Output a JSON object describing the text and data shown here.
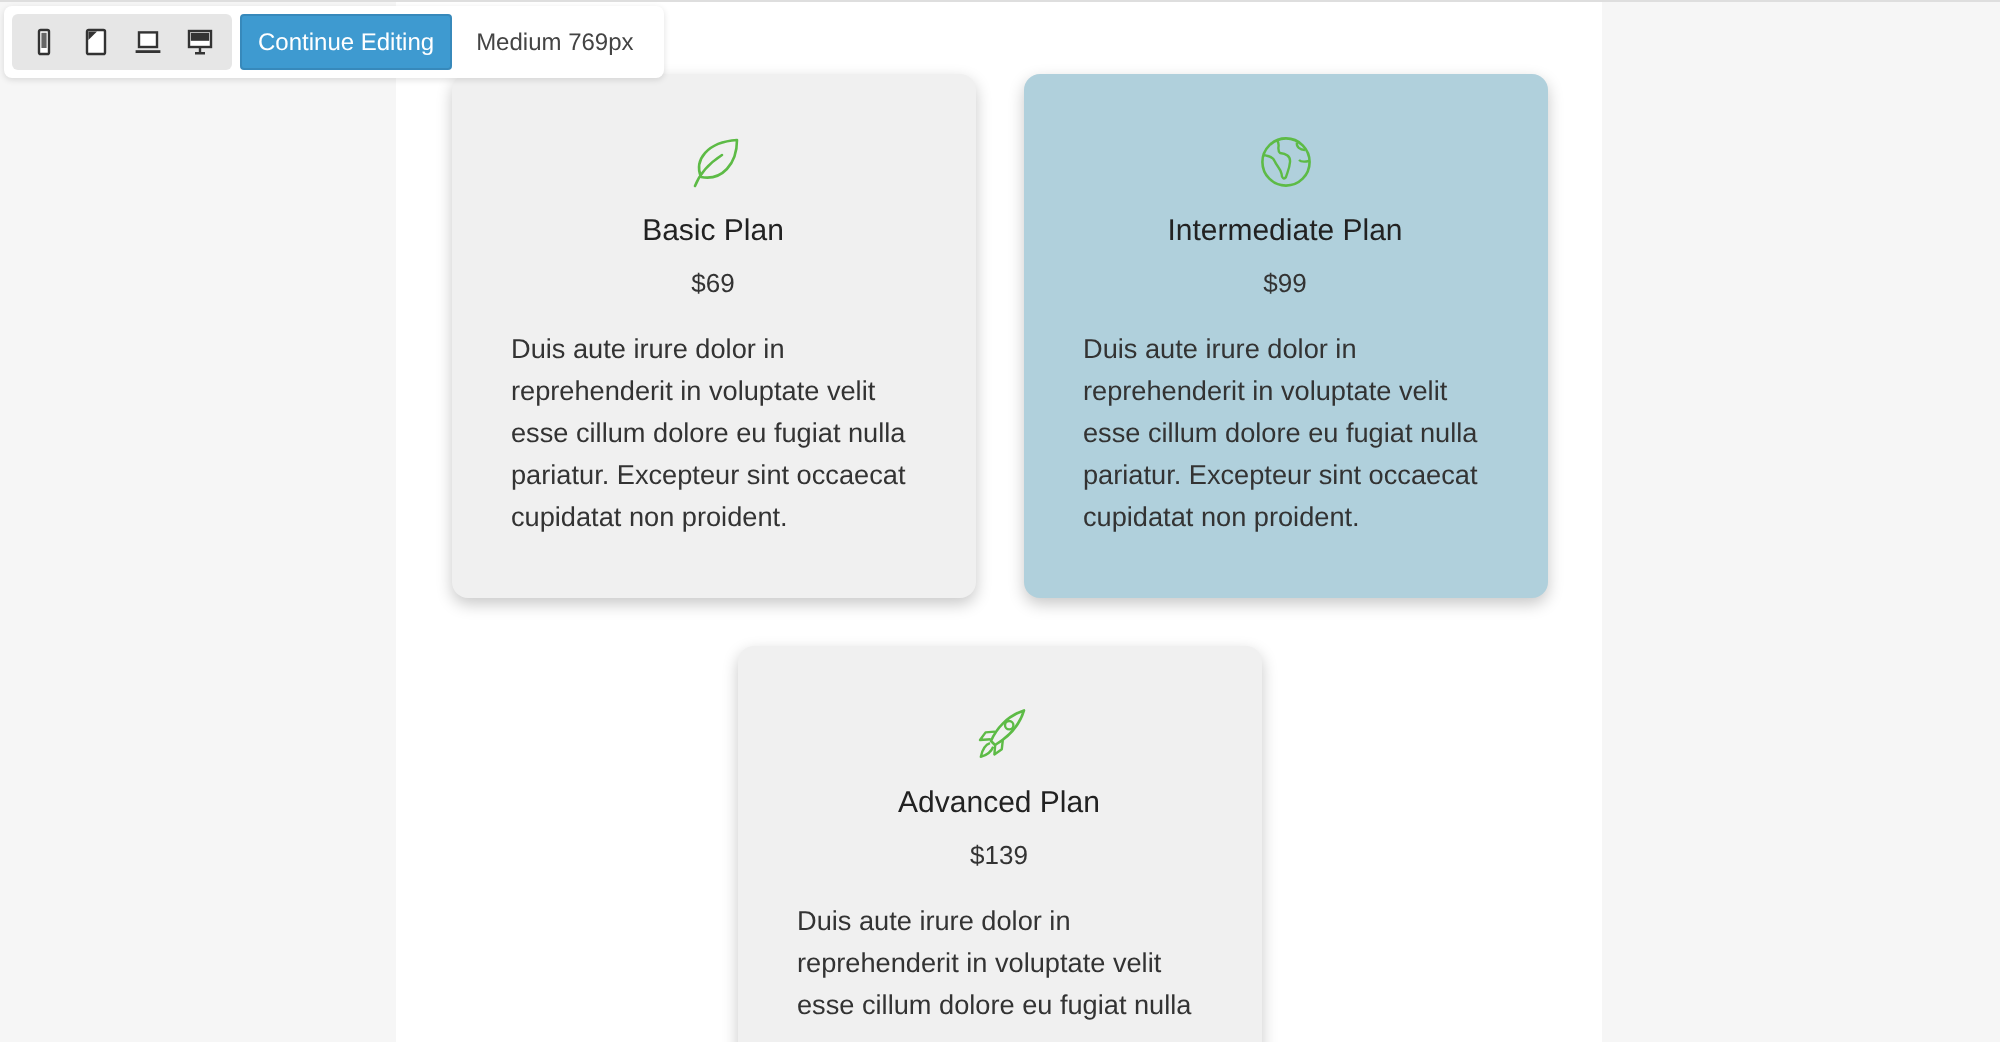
{
  "toolbar": {
    "devices": [
      {
        "kind": "phone"
      },
      {
        "kind": "tablet"
      },
      {
        "kind": "laptop"
      },
      {
        "kind": "desktop"
      }
    ],
    "continue_button": "Continue Editing",
    "breakpoint": "Medium 769px"
  },
  "plans": [
    {
      "kind": "leaf",
      "title": "Basic Plan",
      "price": "$69",
      "description": "Duis aute irure dolor in reprehenderit in voluptate velit esse cillum dolore eu fugiat nulla pariatur. Excepteur sint occaecat cupidatat non proident.",
      "featured": false
    },
    {
      "kind": "globe",
      "title": "Intermediate Plan",
      "price": "$99",
      "description": "Duis aute irure dolor in reprehenderit in voluptate velit esse cillum dolore eu fugiat nulla pariatur. Excepteur sint occaecat cupidatat non proident.",
      "featured": true
    },
    {
      "kind": "rocket",
      "title": "Advanced Plan",
      "price": "$139",
      "description": "Duis aute irure dolor in reprehenderit in voluptate velit esse cillum dolore eu fugiat nulla",
      "featured": false
    }
  ]
}
